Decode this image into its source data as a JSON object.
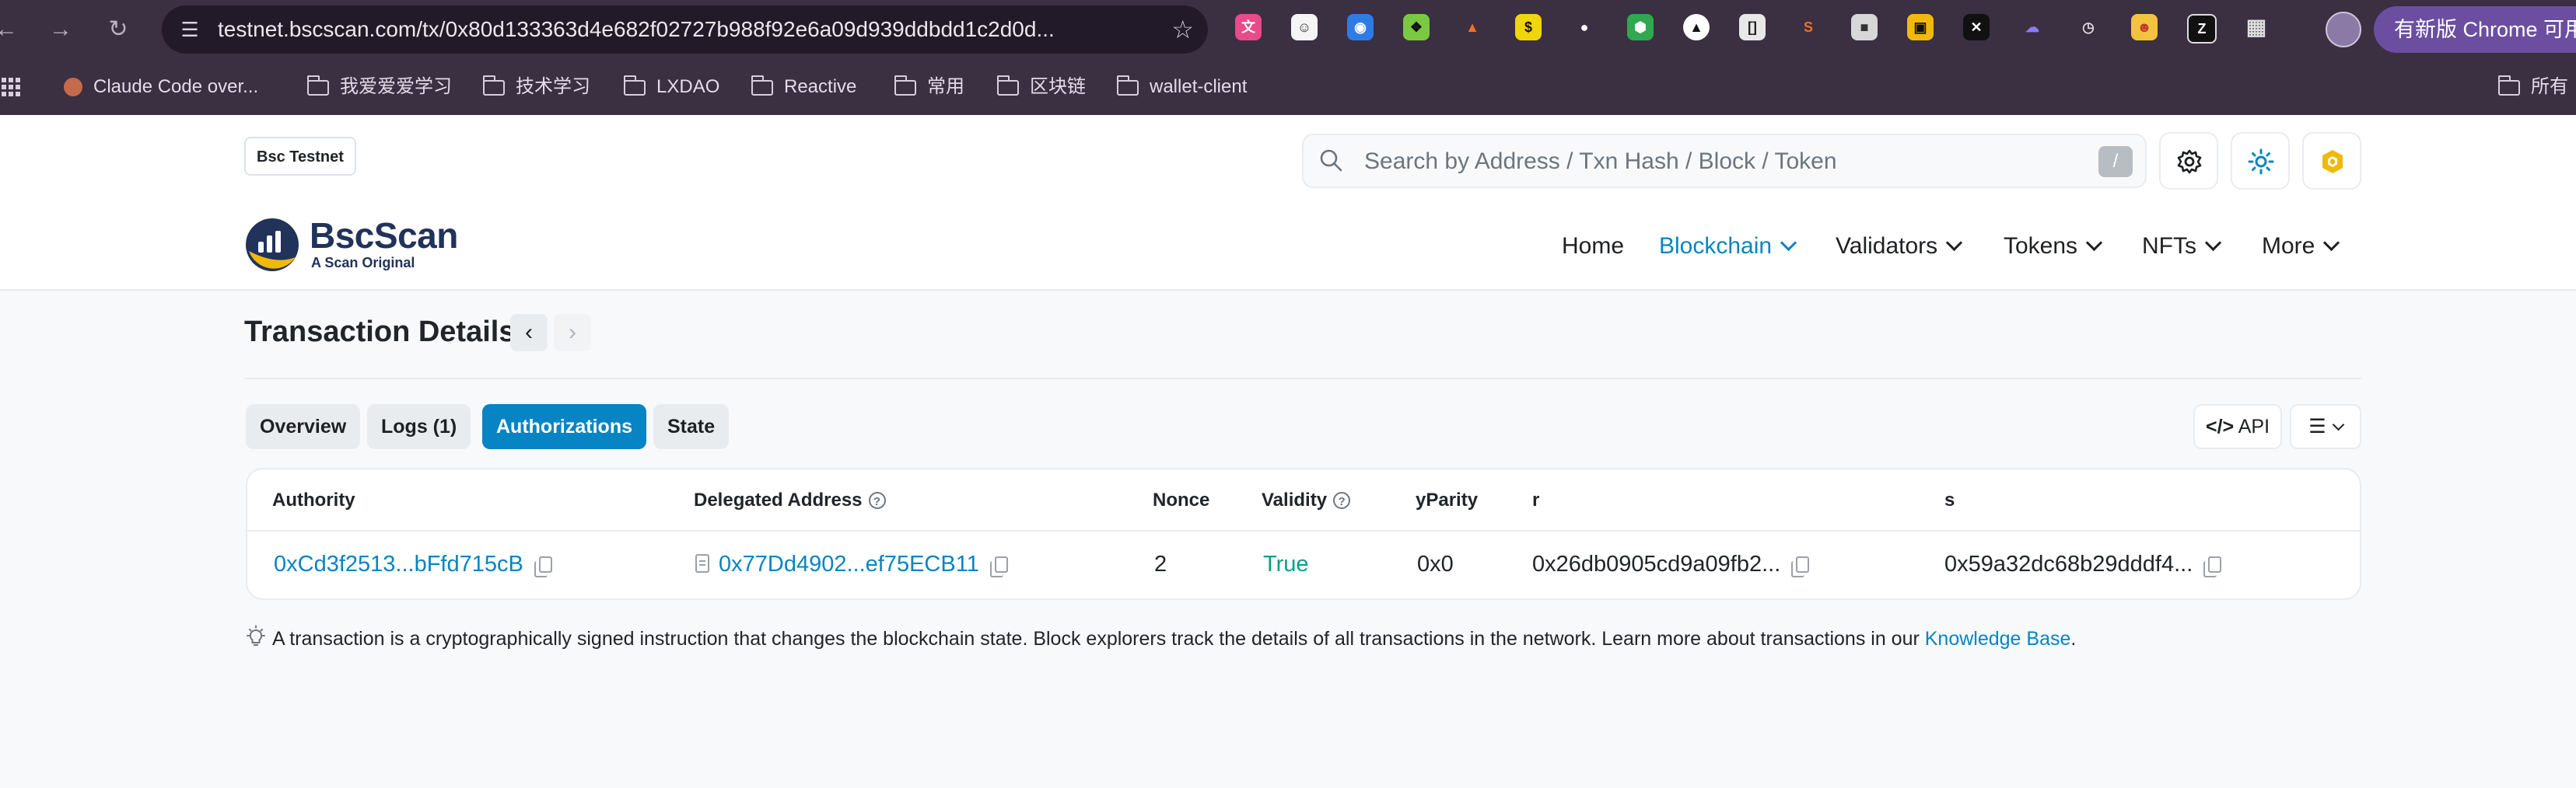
{
  "browser": {
    "url": "testnet.bscscan.com/tx/0x80d133363d4e682f02727b988f92e6a09d939ddbdd1c2d0d...",
    "update_label": "有新版 Chrome 可用",
    "bookmarks": [
      {
        "label": "Claude Code over..."
      },
      {
        "label": "我爱爱爱学习"
      },
      {
        "label": "技术学习"
      },
      {
        "label": "LXDAO"
      },
      {
        "label": "Reactive"
      },
      {
        "label": "常用"
      },
      {
        "label": "区块链"
      },
      {
        "label": "wallet-client"
      },
      {
        "label": "所有"
      }
    ]
  },
  "header": {
    "network_badge": "Bsc Testnet",
    "search_placeholder": "Search by Address / Txn Hash / Block / Token",
    "search_shortcut": "/"
  },
  "brand": {
    "name": "BscScan",
    "tagline": "A Scan Original"
  },
  "nav": [
    {
      "label": "Home"
    },
    {
      "label": "Blockchain"
    },
    {
      "label": "Validators"
    },
    {
      "label": "Tokens"
    },
    {
      "label": "NFTs"
    },
    {
      "label": "More"
    }
  ],
  "page": {
    "title": "Transaction Details",
    "tabs": [
      {
        "label": "Overview"
      },
      {
        "label": "Logs (1)"
      },
      {
        "label": "Authorizations"
      },
      {
        "label": "State"
      }
    ],
    "api_label": "API"
  },
  "table": {
    "headers": [
      "Authority",
      "Delegated Address",
      "Nonce",
      "Validity",
      "yParity",
      "r",
      "s"
    ],
    "rows": [
      {
        "authority": "0xCd3f2513...bFfd715cB",
        "delegated": "0x77Dd4902...ef75ECB11",
        "nonce": "2",
        "validity": "True",
        "yparity": "0x0",
        "r": "0x26db0905cd9a09fb2...",
        "s": "0x59a32dc68b29dddf4..."
      }
    ]
  },
  "footnote": {
    "text": "A transaction is a cryptographically signed instruction that changes the blockchain state. Block explorers track the details of all transactions in the network. Learn more about transactions in our ",
    "link": "Knowledge Base",
    "end": "."
  },
  "colors": {
    "accent": "#0784c3",
    "success": "#00a186",
    "brand_yellow": "#f0b90b",
    "chrome": "#3b2f42"
  }
}
